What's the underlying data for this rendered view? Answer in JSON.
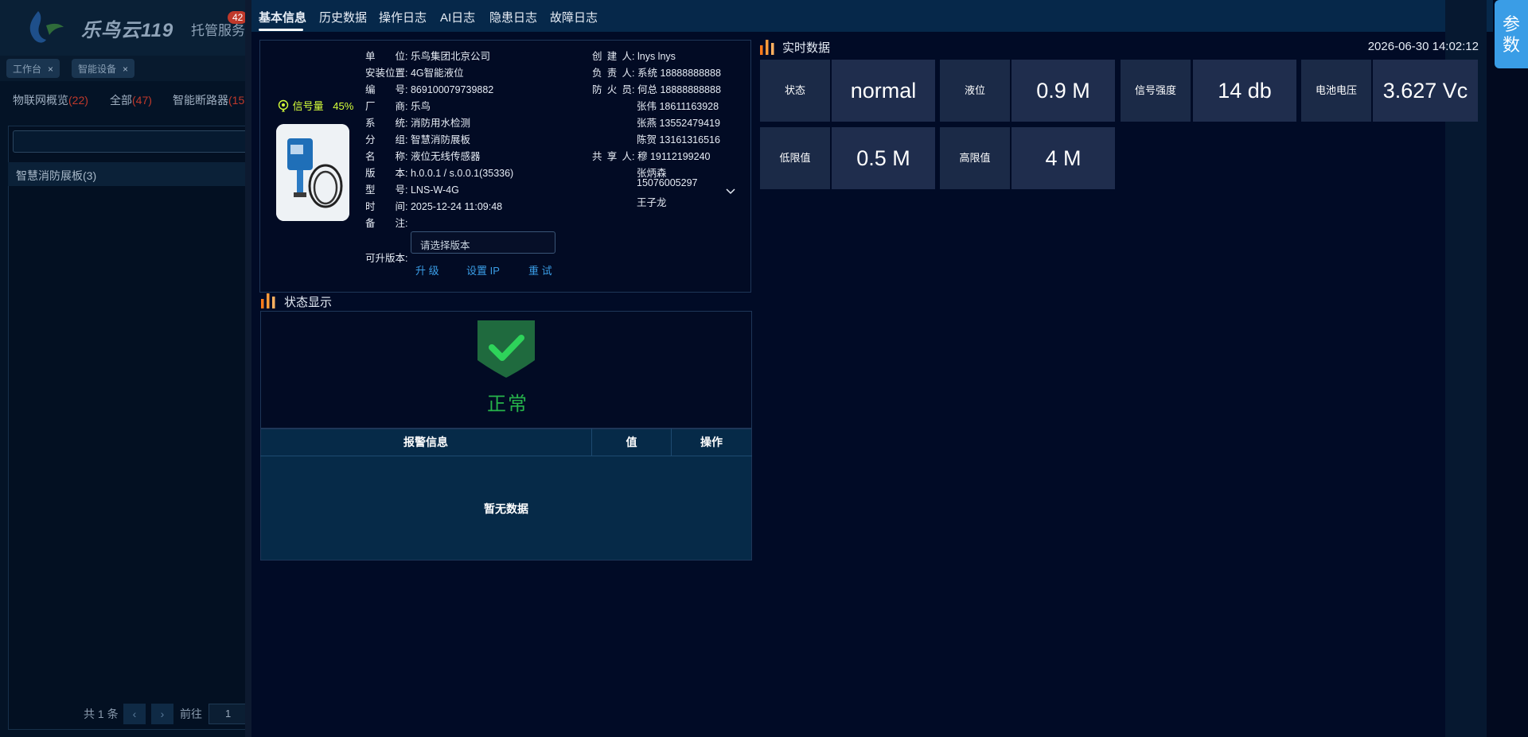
{
  "background_app": {
    "logo_text": "乐鸟云119",
    "hosting_label": "托管服务",
    "hosting_badge": "42",
    "tags": [
      {
        "label": "工作台",
        "close": "×"
      },
      {
        "label": "智能设备",
        "close": "×"
      }
    ],
    "filters": [
      {
        "label": "物联网概览",
        "count": "(22)"
      },
      {
        "label": "全部",
        "count": "(47)"
      },
      {
        "label": "智能断路器",
        "count": "(15"
      }
    ],
    "group_label": "智慧消防展板(3)",
    "pager": {
      "total": "共 1 条",
      "prev": "‹",
      "next": "›",
      "goto": "前往",
      "page": "1"
    }
  },
  "tabs": [
    "基本信息",
    "历史数据",
    "操作日志",
    "AI日志",
    "隐患日志",
    "故障日志"
  ],
  "params_button": "参数",
  "device": {
    "signal_label": "信号量",
    "signal_value": "45%",
    "left_fields": [
      {
        "label": "单位",
        "sep": ":",
        "value": "乐鸟集团北京公司"
      },
      {
        "label": "安装位置",
        "sep": ":",
        "value": "4G智能液位"
      },
      {
        "label": "编号",
        "sep": ":",
        "value": "869100079739882"
      },
      {
        "label": "厂商",
        "sep": ":",
        "value": "乐鸟"
      },
      {
        "label": "系统",
        "sep": ":",
        "value": "消防用水检测"
      },
      {
        "label": "分组",
        "sep": ":",
        "value": "智慧消防展板"
      },
      {
        "label": "名称",
        "sep": ":",
        "value": "液位无线传感器"
      },
      {
        "label": "版本",
        "sep": ":",
        "value": "h.0.0.1 / s.0.0.1(35336)"
      },
      {
        "label": "型号",
        "sep": ":",
        "value": "LNS-W-4G"
      },
      {
        "label": "时间",
        "sep": ":",
        "value": "2025-12-24 11:09:48"
      },
      {
        "label": "备注",
        "sep": ":",
        "value": ""
      }
    ],
    "upgrade_label": "可升版本:",
    "version_placeholder": "请选择版本",
    "actions": [
      "升 级",
      "设置 IP",
      "重 试"
    ],
    "right_fields": [
      {
        "label": "创建人",
        "sep": ":",
        "value": "lnys lnys"
      },
      {
        "label": "负责人",
        "sep": ":",
        "value": "系统 18888888888"
      },
      {
        "label": "防火员",
        "sep": ":",
        "value": "何总 18888888888"
      },
      {
        "label": "",
        "sep": "",
        "value": "张伟 18611163928"
      },
      {
        "label": "",
        "sep": "",
        "value": "张燕 13552479419"
      },
      {
        "label": "",
        "sep": "",
        "value": "陈贺 13161316516"
      },
      {
        "label": "共享人",
        "sep": ":",
        "value": "穆 19112199240"
      },
      {
        "label": "",
        "sep": "",
        "value": "张炳森"
      },
      {
        "label": "",
        "sep": "",
        "value": "15076005297"
      },
      {
        "label": "",
        "sep": "",
        "value": "王子龙"
      }
    ]
  },
  "status_section": {
    "title": "状态显示",
    "status_text": "正常",
    "table_headers": [
      "报警信息",
      "值",
      "操作"
    ],
    "empty_text": "暂无数据"
  },
  "realtime": {
    "title": "实时数据",
    "timestamp": "2026-06-30 14:02:12",
    "metrics": [
      {
        "label": "状态",
        "value": "normal"
      },
      {
        "label": "液位",
        "value": "0.9 M"
      },
      {
        "label": "信号强度",
        "value": "14 db"
      },
      {
        "label": "电池电压",
        "value": "3.627 Vc"
      },
      {
        "label": "低限值",
        "value": "0.5 M"
      },
      {
        "label": "高限值",
        "value": "4 M"
      }
    ]
  },
  "colors": {
    "accent_blue": "#3a9de6",
    "status_green": "#26b34a",
    "signal_yellow": "#d6ff3a",
    "alert_red": "#c0392b"
  },
  "icons": [
    "signal-icon",
    "chart-bars-icon",
    "shield-check-icon",
    "chevron-down-icon",
    "close-icon",
    "logo-icon"
  ]
}
